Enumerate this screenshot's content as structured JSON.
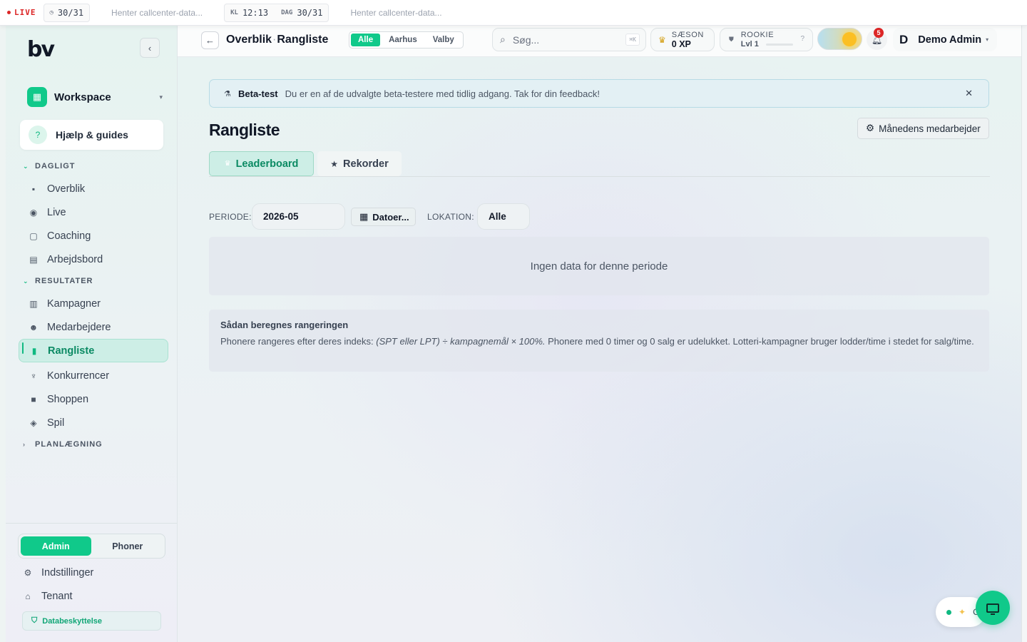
{
  "ticker": {
    "live_label": "LIVE",
    "day_counter": "30/31",
    "loading_text_1": "Henter callcenter-data...",
    "clock_key": "KL",
    "clock_value": "12:13",
    "day_key": "DAG",
    "day_value": "30/31",
    "loading_text_2": "Henter callcenter-data..."
  },
  "sidebar": {
    "logo": "bv",
    "workspace_label": "Workspace",
    "help_label": "Hjælp & guides",
    "section_daily": "DAGLIGT",
    "daily_items": [
      {
        "label": "Overblik",
        "icon": "dashboard-icon"
      },
      {
        "label": "Live",
        "icon": "broadcast-icon"
      },
      {
        "label": "Coaching",
        "icon": "chat-icon"
      },
      {
        "label": "Arbejdsbord",
        "icon": "calendar-icon"
      }
    ],
    "section_results": "RESULTATER",
    "result_items": [
      {
        "label": "Kampagner",
        "icon": "bar-chart-icon"
      },
      {
        "label": "Medarbejdere",
        "icon": "people-icon"
      },
      {
        "label": "Rangliste",
        "icon": "ranking-icon",
        "active": true
      },
      {
        "label": "Konkurrencer",
        "icon": "trophy-icon"
      },
      {
        "label": "Shoppen",
        "icon": "bag-icon"
      },
      {
        "label": "Spil",
        "icon": "gamepad-icon"
      }
    ],
    "section_planning": "PLANLÆGNING",
    "role_admin": "Admin",
    "role_phoner": "Phoner",
    "settings_label": "Indstillinger",
    "tenant_label": "Tenant",
    "privacy_label": "Databeskyttelse"
  },
  "topnav": {
    "crumb_parent": "Overblik",
    "crumb_separator": "·",
    "crumb_current": "Rangliste",
    "locations": [
      "Alle",
      "Aarhus",
      "Valby"
    ],
    "active_location": "Alle",
    "search_placeholder": "Søg...",
    "search_shortcut": "⌘K",
    "season_label": "SÆSON",
    "season_xp": "0 XP",
    "rank_label": "ROOKIE",
    "rank_level": "Lvl 1",
    "rank_help": "?",
    "notifications_count": "5",
    "user_initial": "D",
    "user_name": "Demo Admin"
  },
  "main": {
    "beta_title": "Beta-test",
    "beta_message": "Du er en af de udvalgte beta-testere med tidlig adgang. Tak for din feedback!",
    "page_title": "Rangliste",
    "month_button": "Månedens medarbejder",
    "tabs": [
      {
        "label": "Leaderboard",
        "active": true
      },
      {
        "label": "Rekorder",
        "active": false
      }
    ],
    "filter_period_label": "PERIODE:",
    "filter_period_value": "2026-05",
    "filter_dates_button": "Datoer...",
    "filter_location_label": "LOKATION:",
    "filter_location_value": "Alle",
    "empty_text": "Ingen data for denne periode",
    "explain_title": "Sådan beregnes rangeringen",
    "explain_text_1": "Phonere rangeres efter deres indeks: ",
    "explain_formula": "(SPT eller LPT) ÷ kampagnemål × 100%.",
    "explain_text_2": " Phonere med 0 timer og 0 salg er udelukket. Lotteri-kampagner bruger lodder/time i stedet for salg/time."
  },
  "floating": {
    "pill_text": "C"
  },
  "colors": {
    "accent": "#10c98a",
    "accent_dark": "#0b8a63",
    "live_red": "#dc2626"
  }
}
